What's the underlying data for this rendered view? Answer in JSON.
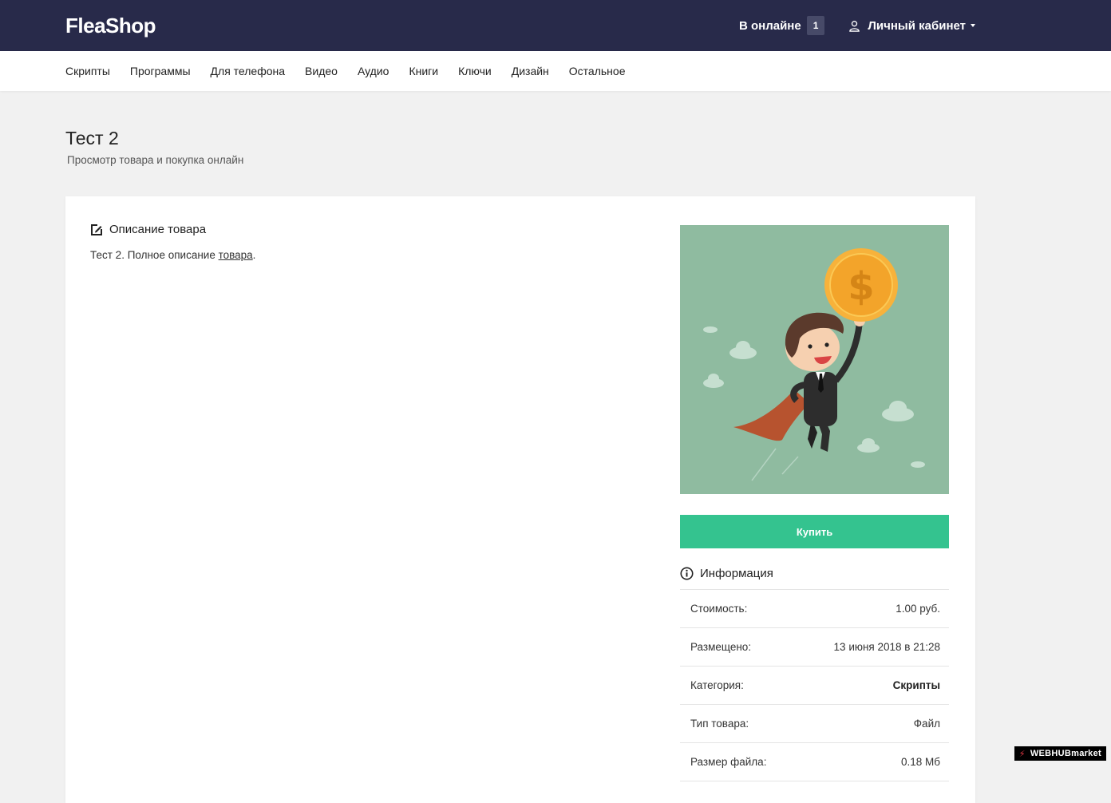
{
  "header": {
    "logo": "FleaShop",
    "online_label": "В онлайне",
    "online_count": "1",
    "account_label": "Личный кабинет"
  },
  "nav": {
    "items": [
      "Скрипты",
      "Программы",
      "Для телефона",
      "Видео",
      "Аудио",
      "Книги",
      "Ключи",
      "Дизайн",
      "Остальное"
    ]
  },
  "page": {
    "title": "Тест 2",
    "subtitle": "Просмотр товара и покупка онлайн"
  },
  "description": {
    "heading": "Описание товара",
    "text_before": "Тест 2. Полное описание ",
    "link_text": "товара",
    "text_after": "."
  },
  "buy_label": "Купить",
  "info": {
    "heading": "Информация",
    "rows": [
      {
        "label": "Стоимость:",
        "value": "1.00 руб."
      },
      {
        "label": "Размещено:",
        "value": "13 июня 2018 в 21:28"
      },
      {
        "label": "Категория:",
        "value": "Скрипты"
      },
      {
        "label": "Тип товара:",
        "value": "Файл"
      },
      {
        "label": "Размер файла:",
        "value": "0.18 Мб"
      }
    ]
  },
  "watermark": "WEBHUBmarket",
  "colors": {
    "topbar": "#282a4a",
    "buy_button": "#34c38f",
    "image_bg": "#8fbba0"
  }
}
